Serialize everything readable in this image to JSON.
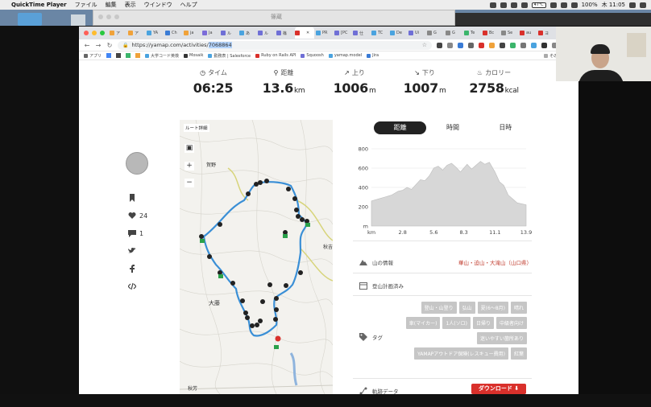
{
  "menubar": {
    "app": "QuickTime Player",
    "items": [
      "ファイル",
      "編集",
      "表示",
      "ウインドウ",
      "ヘルプ"
    ],
    "battery_temp": "47℃",
    "battery": "100%",
    "clock": "木 11:05"
  },
  "finder_title": "篠蔵",
  "tabs": [
    {
      "label": "ア",
      "color": "#f0a23a"
    },
    {
      "label": "ア",
      "color": "#f0a23a"
    },
    {
      "label": "YA",
      "color": "#4aa3df"
    },
    {
      "label": "Ch",
      "color": "#3a7bd5"
    },
    {
      "label": "ja",
      "color": "#f0a23a"
    },
    {
      "label": "Ja",
      "color": "#7b6cd9"
    },
    {
      "label": "ル",
      "color": "#6f6fd6"
    },
    {
      "label": "あ",
      "color": "#4aa3df"
    },
    {
      "label": "ル",
      "color": "#6f6fd6"
    },
    {
      "label": "篠",
      "color": "#6f6fd6"
    },
    {
      "label": "",
      "color": "#d9302b",
      "active": true
    },
    {
      "label": "PR",
      "color": "#4aa3df"
    },
    {
      "label": "[PC",
      "color": "#6f6fd6"
    },
    {
      "label": "仕",
      "color": "#6f6fd6"
    },
    {
      "label": "TC",
      "color": "#4aa3df"
    },
    {
      "label": "De",
      "color": "#4aa3df"
    },
    {
      "label": "Ui",
      "color": "#6f6fd6"
    },
    {
      "label": "G",
      "color": "#888888"
    },
    {
      "label": "G",
      "color": "#888888"
    },
    {
      "label": "Te",
      "color": "#3bb56b"
    },
    {
      "label": "Bc",
      "color": "#d9302b"
    },
    {
      "label": "Se",
      "color": "#888888"
    },
    {
      "label": "au",
      "color": "#d9302b"
    },
    {
      "label": "ヨ",
      "color": "#d9302b"
    }
  ],
  "url": {
    "base": "https://yamap.com/activities/",
    "selected": "7068864"
  },
  "bookmarks": [
    {
      "label": "アプリ",
      "color": "#666666"
    },
    {
      "label": "大学コード英検",
      "color": "#4aa3df"
    },
    {
      "label": "Mosaik",
      "color": "#333333"
    },
    {
      "label": "勤務表 | Salesforce",
      "color": "#4aa3df"
    },
    {
      "label": "Ruby on Rails API",
      "color": "#d9302b"
    },
    {
      "label": "Squoosh",
      "color": "#6f6fd6"
    },
    {
      "label": "yamap.model",
      "color": "#4aa3df"
    },
    {
      "label": "Jira",
      "color": "#3a7bd5"
    }
  ],
  "bookmarks_other": "その他のブッ",
  "stats": [
    {
      "label": "タイム",
      "icon": "clock-icon",
      "glyph": "◷",
      "value": "06:25",
      "unit": ""
    },
    {
      "label": "距離",
      "icon": "hiker-icon",
      "glyph": "⚲",
      "value": "13.6",
      "unit": "km"
    },
    {
      "label": "上り",
      "icon": "arrow-up-right-icon",
      "glyph": "↗",
      "value": "1006",
      "unit": "m"
    },
    {
      "label": "下り",
      "icon": "arrow-down-right-icon",
      "glyph": "↘",
      "value": "1007",
      "unit": "m"
    },
    {
      "label": "カロリー",
      "icon": "flame-icon",
      "glyph": "♨",
      "value": "2758",
      "unit": "kcal"
    }
  ],
  "social": {
    "likes": "24",
    "comments": "1"
  },
  "map": {
    "label": "ルート詳細",
    "place1": "賀野",
    "place2": "大藤",
    "place3": "秋吉",
    "place4": "秋芳"
  },
  "chart_tabs": [
    "距離",
    "時間",
    "日時"
  ],
  "chart_data": {
    "type": "area",
    "title": "",
    "xlabel": "km",
    "ylabel": "m",
    "xlim": [
      0,
      13.9
    ],
    "ylim": [
      0,
      800
    ],
    "xticks": [
      "km",
      "2.8",
      "5.6",
      "8.3",
      "11.1",
      "13.9"
    ],
    "yticks": [
      "800",
      "600",
      "400",
      "200",
      "m"
    ],
    "x": [
      0,
      0.6,
      1.2,
      1.8,
      2.4,
      2.8,
      3.2,
      3.6,
      4.0,
      4.4,
      4.8,
      5.2,
      5.6,
      6.0,
      6.4,
      6.8,
      7.2,
      7.6,
      8.0,
      8.3,
      8.6,
      9.0,
      9.4,
      9.8,
      10.2,
      10.6,
      11.1,
      11.5,
      11.9,
      12.3,
      12.7,
      13.1,
      13.5,
      13.9
    ],
    "y": [
      260,
      280,
      300,
      320,
      360,
      370,
      400,
      380,
      430,
      480,
      470,
      520,
      600,
      620,
      580,
      630,
      650,
      610,
      560,
      600,
      640,
      590,
      630,
      670,
      640,
      660,
      560,
      460,
      420,
      320,
      280,
      240,
      230,
      220
    ]
  },
  "info": {
    "mountain_label": "山の情報",
    "mountain_link": "華山・迫山・大滝山（山口県）",
    "plan_label": "登山計画済み",
    "tag_label": "タグ",
    "track_label": "軌跡データ"
  },
  "tags": [
    "登山・山登り",
    "弘山",
    "夏(6〜8月)",
    "晴れ",
    "車(マイカー)",
    "1人(ソロ)",
    "日帰り",
    "中級者向け",
    "迷いやすい箇所あり",
    "YAMAPアウトドア保険(レスキュー費用)",
    "紅葉"
  ],
  "download_label": "ダウンロード ⬇"
}
